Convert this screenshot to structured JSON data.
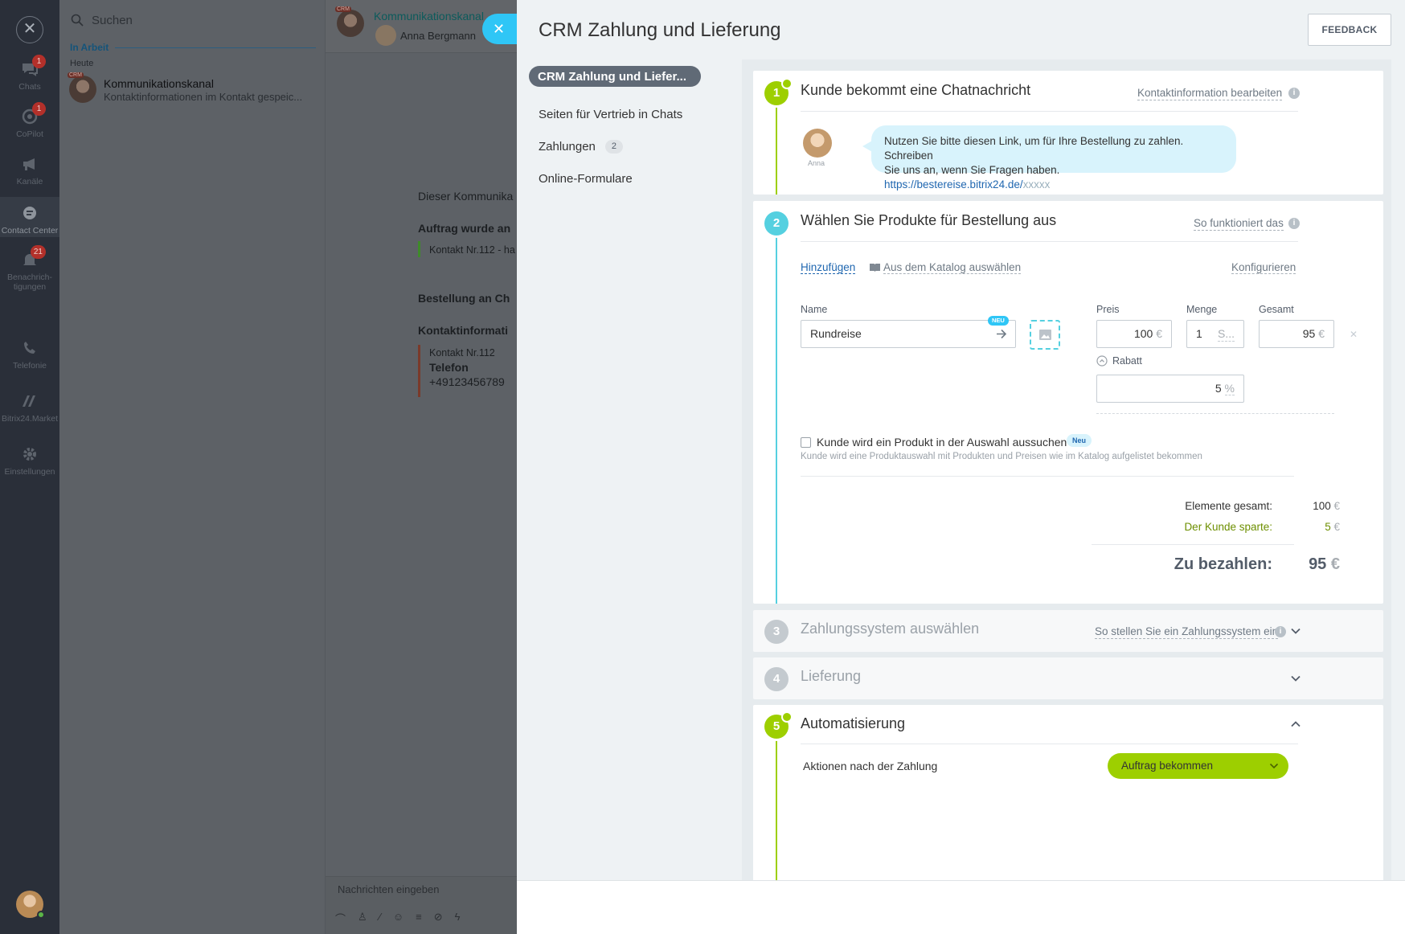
{
  "nav": {
    "close_icon": "close-icon",
    "items": [
      {
        "label": "Chats",
        "icon": "chat-icon",
        "badge": "1"
      },
      {
        "label": "CoPilot",
        "icon": "copilot-icon",
        "badge": "1"
      },
      {
        "label": "Kanäle",
        "icon": "megaphone-icon",
        "badge": ""
      },
      {
        "label": "Contact Center",
        "icon": "contact-center-icon",
        "badge": ""
      },
      {
        "label": "Benachrich-",
        "label2": "tigungen",
        "icon": "bell-icon",
        "badge": "21"
      },
      {
        "label": "Telefonie",
        "icon": "phone-icon",
        "badge": ""
      },
      {
        "label": "Bitrix24.Market",
        "icon": "market-icon",
        "badge": ""
      },
      {
        "label": "Einstellungen",
        "icon": "gear-icon",
        "badge": ""
      }
    ]
  },
  "chatlist": {
    "search_placeholder": "Suchen",
    "group": "In Arbeit",
    "date": "Heute",
    "items": [
      {
        "title": "Kommunikationskanal",
        "subtitle": "Kontaktinformationen im Kontakt gespeic...",
        "badge": "CRM"
      }
    ]
  },
  "chat": {
    "title": "Kommunikationskanal",
    "user": "Anna Bergmann",
    "badge": "CRM",
    "messages": {
      "m1": "Dieser Kommunika",
      "m2": "Auftrag wurde an",
      "m3": "Kontakt Nr.112 - ha",
      "m4": "Bestellung an Ch",
      "m5": "Kontaktinformati",
      "m6": "Kontakt Nr.112",
      "m7": "Telefon",
      "m8": "+49123456789"
    },
    "compose_placeholder": "Nachrichten eingeben"
  },
  "slider": {
    "title": "CRM Zahlung und Lieferung",
    "feedback": "FEEDBACK",
    "menu": [
      {
        "label": "CRM Zahlung und Liefer...",
        "count": ""
      },
      {
        "label": "Seiten für Vertrieb in Chats",
        "count": ""
      },
      {
        "label": "Zahlungen",
        "count": "2"
      },
      {
        "label": "Online-Formulare",
        "count": ""
      }
    ],
    "step1": {
      "num": "1",
      "title": "Kunde bekommt eine Chatnachricht",
      "link": "Kontaktinformation bearbeiten",
      "avatar_name": "Anna",
      "message_line1": "Nutzen Sie bitte diesen Link, um für Ihre Bestellung zu zahlen. Schreiben",
      "message_line2": "Sie uns an, wenn Sie Fragen haben.",
      "url": "https://bestereise.bitrix24.de/",
      "url_suffix": "xxxxx"
    },
    "step2": {
      "num": "2",
      "title": "Wählen Sie Produkte für Bestellung aus",
      "link": "So funktioniert das",
      "add": "Hinzufügen",
      "catalog": "Aus dem Katalog auswählen",
      "configure": "Konfigurieren",
      "name_label": "Name",
      "name_value": "Rundreise",
      "new_badge": "NEU",
      "price_label": "Preis",
      "price_value": "100",
      "qty_label": "Menge",
      "qty_value": "1",
      "qty_unit": "S...",
      "total_label": "Gesamt",
      "total_value": "95",
      "currency": "€",
      "discount_label": "Rabatt",
      "discount_value": "5",
      "discount_unit": "%",
      "checkbox_label": "Kunde wird ein Produkt in der Auswahl aussuchen",
      "checkbox_badge": "Neu",
      "checkbox_hint": "Kunde wird eine Produktauswahl mit Produkten und Preisen wie im Katalog aufgelistet bekommen",
      "elements_label": "Elemente gesamt:",
      "elements_value": "100",
      "saved_label": "Der Kunde sparte:",
      "saved_value": "5",
      "pay_label": "Zu bezahlen:",
      "pay_value": "95"
    },
    "step3": {
      "num": "3",
      "title": "Zahlungssystem auswählen",
      "link": "So stellen Sie ein Zahlungssystem ein"
    },
    "step4": {
      "num": "4",
      "title": "Lieferung"
    },
    "step5": {
      "num": "5",
      "title": "Automatisierung",
      "action_label": "Aktionen nach der Zahlung",
      "action_value": "Auftrag bekommen"
    },
    "colors": {
      "accent": "#2fc6f6",
      "green": "#9dcf00",
      "step_blue": "#55d0e0",
      "link": "#2067b0"
    }
  }
}
